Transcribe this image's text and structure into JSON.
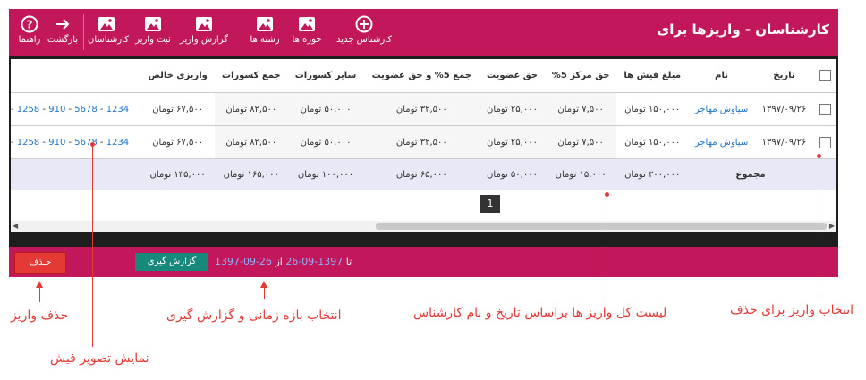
{
  "window": {
    "title": "کارشناسان - واریزها برای"
  },
  "toolbar": {
    "new_expert": "کارشناس جدید",
    "domains": "حوزه ها",
    "fields": "رشته ها",
    "deposit_report": "گزارش واریز",
    "register_deposit": "ثبت واریز",
    "experts": "کارشناسان",
    "back": "بازگشت",
    "help": "راهنما"
  },
  "table": {
    "headers": {
      "date": "تاریخ",
      "name": "نام",
      "receipt_amount": "مبلغ فیش ها",
      "center_fee": "حق مرکز 5%",
      "membership": "حق عضویت",
      "sum_5_membership": "جمع 5% و حق عضویت",
      "other_deductions": "سایر کسورات",
      "total_deductions": "جمع کسورات",
      "net_deposit": "واریزی خالص"
    },
    "rows": [
      {
        "date": "۱۳۹۷/۰۹/۲۶",
        "name": "سیاوش مهاجر",
        "receipt_amount": "۱۵۰,۰۰۰ تومان",
        "center_fee": "۷,۵۰۰ تومان",
        "membership": "۲۵,۰۰۰ تومان",
        "sum_5_membership": "۳۲,۵۰۰ تومان",
        "other_deductions": "۵۰,۰۰۰ تومان",
        "total_deductions": "۸۲,۵۰۰ تومان",
        "net_deposit": "۶۷,۵۰۰ تومان",
        "receipts": [
          "1234",
          "5678",
          "910",
          "1258"
        ]
      },
      {
        "date": "۱۳۹۷/۰۹/۲۶",
        "name": "سیاوش مهاجر",
        "receipt_amount": "۱۵۰,۰۰۰ تومان",
        "center_fee": "۷,۵۰۰ تومان",
        "membership": "۲۵,۰۰۰ تومان",
        "sum_5_membership": "۳۲,۵۰۰ تومان",
        "other_deductions": "۵۰,۰۰۰ تومان",
        "total_deductions": "۸۲,۵۰۰ تومان",
        "net_deposit": "۶۷,۵۰۰ تومان",
        "receipts": [
          "1234",
          "5678",
          "910",
          "1258"
        ]
      }
    ],
    "total": {
      "label": "مجموع",
      "receipt_amount": "۳۰۰,۰۰۰ تومان",
      "center_fee": "۱۵,۰۰۰ تومان",
      "membership": "۵۰,۰۰۰ تومان",
      "sum_5_membership": "۶۵,۰۰۰ تومان",
      "other_deductions": "۱۰۰,۰۰۰ تومان",
      "total_deductions": "۱۶۵,۰۰۰ تومان",
      "net_deposit": "۱۳۵,۰۰۰ تومان"
    },
    "page": "1"
  },
  "footer": {
    "from_label": "از",
    "from_date": "1397-09-26",
    "to_label": "تا",
    "to_date": "1397-09-26",
    "report_button": "گزارش گیری",
    "delete_button": "حـذف"
  },
  "annotations": {
    "select_for_delete": "انتخاب واریز برای حذف",
    "list_all": "لیست کل واریز ها براساس تاریخ و نام کارشناس",
    "date_range": "انتخاب بازه زمانی و گزارش گیری",
    "delete_deposit": "حذف واریز",
    "show_receipt": "نمایش تصویر فیش"
  },
  "colors": {
    "toolbar": "#c2185b",
    "link": "#1a73c8",
    "annotation": "#e53935",
    "report_button": "#17897a",
    "delete_button": "#e53935"
  }
}
